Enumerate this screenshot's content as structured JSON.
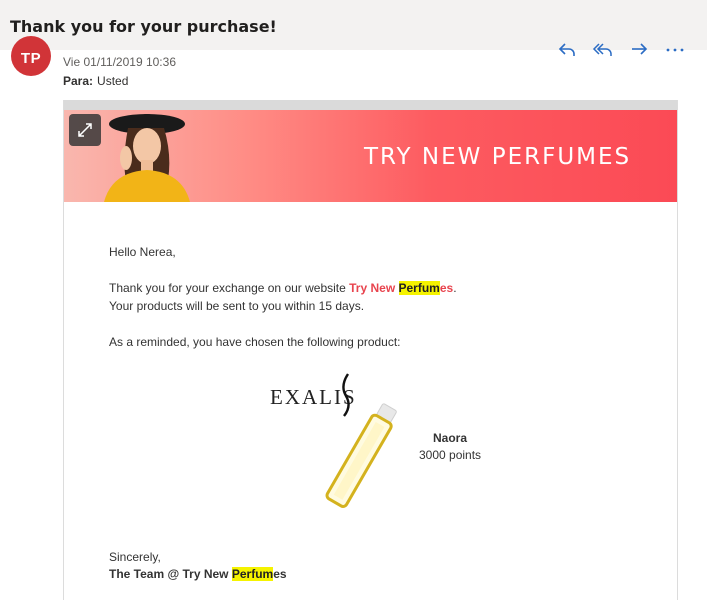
{
  "subject": "Thank you for your purchase!",
  "header": {
    "avatar_initials": "TP",
    "date": "Vie 01/11/2019 10:36",
    "to_label": "Para:",
    "to_value": "Usted",
    "actions": [
      "reply-icon",
      "reply-all-icon",
      "forward-icon",
      "more-icon"
    ]
  },
  "banner": {
    "title": "TRY NEW PERFUMES",
    "expand_icon": "expand-icon",
    "gradient": [
      "#f9b7ae",
      "#fb4a55"
    ]
  },
  "email": {
    "greeting": "Hello Nerea,",
    "line1_prefix": "Thank you for your exchange on our website ",
    "brand_part1": "Try New ",
    "brand_highlight": "Perfum",
    "brand_suffix": "es",
    "line1_end": ".",
    "line2": "Your products will be sent to you within 15 days.",
    "line3": "As a reminded, you have chosen the following product:",
    "closing": "Sincerely,",
    "signature_prefix": "The Team @ Try New ",
    "signature_highlight": "Perfum",
    "signature_suffix": "es"
  },
  "product": {
    "logo_text": "EXALIS",
    "name": "Naora",
    "points": "3000 points"
  },
  "colors": {
    "avatar": "#d13438",
    "brand_red": "#e8444e",
    "highlight": "#f5f300"
  }
}
